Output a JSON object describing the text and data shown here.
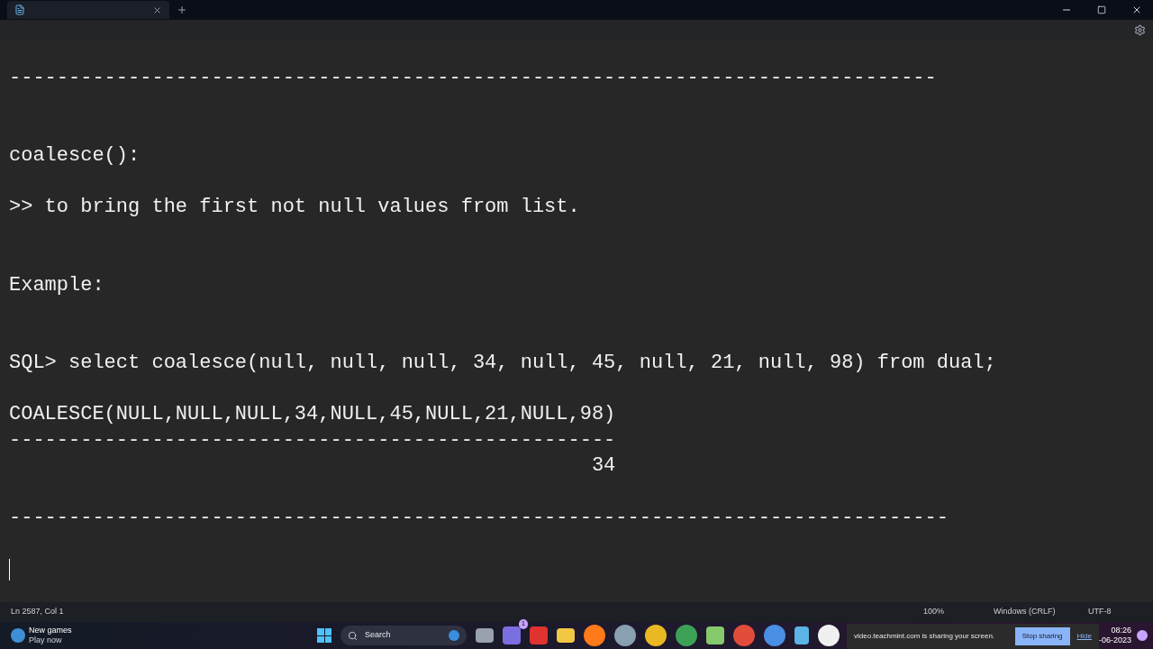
{
  "editor": {
    "lines": [
      "------------------------------------------------------------------------------",
      "coalesce():",
      ">> to bring the first not null values from list.",
      "Example:",
      "SQL> select coalesce(null, null, null, 34, null, 45, null, 21, null, 98) from dual;",
      "COALESCE(NULL,NULL,NULL,34,NULL,45,NULL,21,NULL,98)",
      "---------------------------------------------------",
      "                                                 34",
      "-------------------------------------------------------------------------------"
    ]
  },
  "status_bar": {
    "position": "Ln 2587, Col 1",
    "zoom": "100%",
    "line_ending": "Windows (CRLF)",
    "encoding": "UTF-8"
  },
  "taskbar": {
    "widget": {
      "title": "New games",
      "subtitle": "Play now"
    },
    "search": {
      "placeholder": "Search"
    },
    "teams_badge": "1",
    "sharing": {
      "message": "video.teachmint.com is sharing your screen.",
      "stop": "Stop sharing",
      "hide": "Hide"
    },
    "clock": {
      "time": "08:26",
      "date": "-06-2023"
    }
  }
}
